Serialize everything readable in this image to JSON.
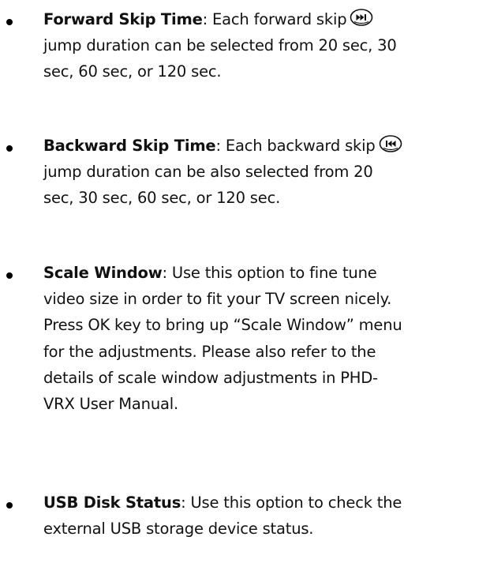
{
  "items": [
    {
      "term": "Forward Skip Time",
      "text_before_icon": ": Each forward skip",
      "icon": "forward-skip-icon",
      "lines": [
        "jump duration can be selected from 20 sec, 30",
        "sec, 60 sec, or 120 sec."
      ]
    },
    {
      "term": "Backward Skip Time",
      "text_before_icon": ": Each backward skip",
      "icon": "backward-skip-icon",
      "lines": [
        "jump duration can be also selected from 20",
        "sec, 30 sec, 60 sec, or 120 sec."
      ]
    },
    {
      "term": "Scale Window",
      "first_line_rest": ": Use this option to fine tune",
      "lines": [
        "video size in order to fit your TV screen nicely.",
        "Press OK key to bring up “Scale Window” menu",
        "for the adjustments. Please also refer to the",
        "details of scale window adjustments in PHD-",
        "VRX User Manual."
      ]
    },
    {
      "term": "USB Disk Status",
      "first_line_rest": ": Use this option to check the",
      "lines": [
        "external USB storage device status."
      ]
    }
  ]
}
